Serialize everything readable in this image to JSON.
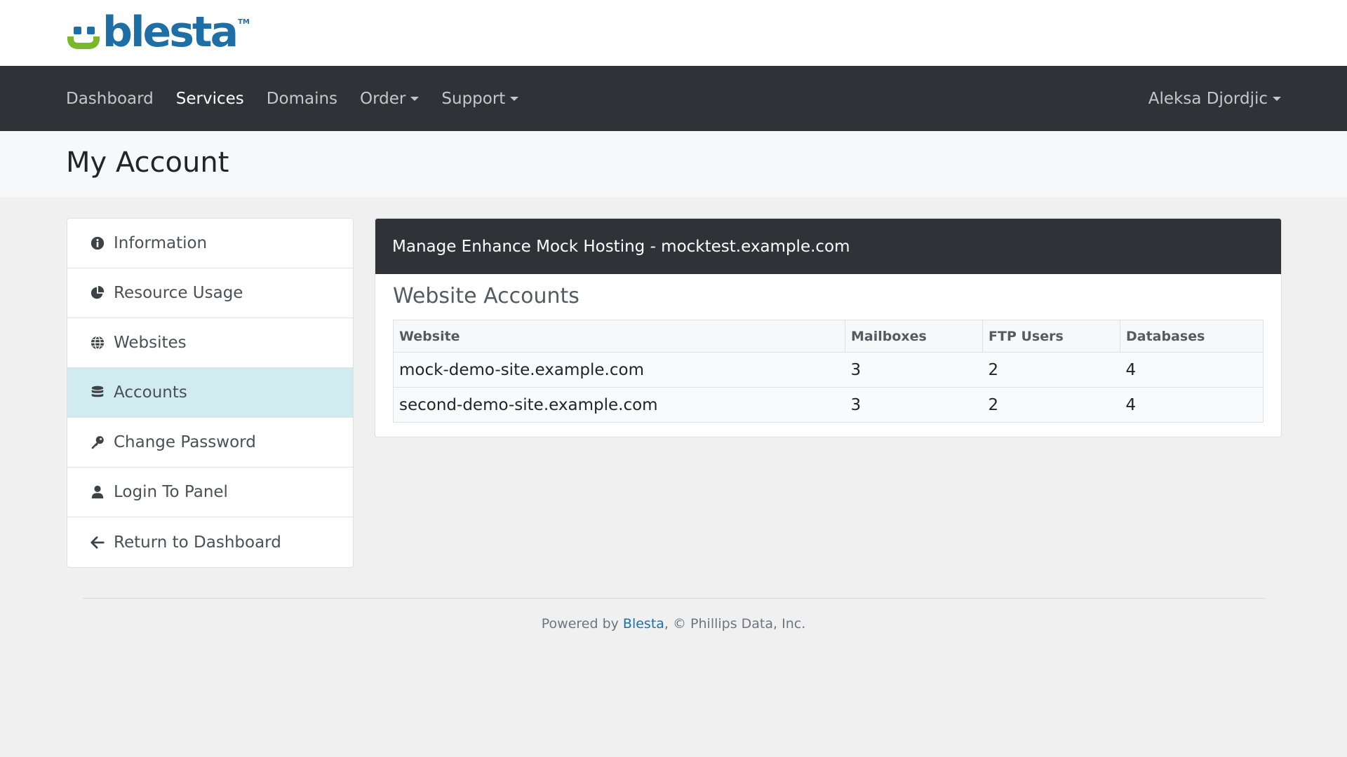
{
  "brand": {
    "logo_text": "blesta",
    "logo_tm": "TM",
    "colors": {
      "primary": "#1d6fa5",
      "green": "#78b82a"
    }
  },
  "navbar": {
    "items": [
      {
        "label": "Dashboard",
        "active": false,
        "dropdown": false
      },
      {
        "label": "Services",
        "active": true,
        "dropdown": false
      },
      {
        "label": "Domains",
        "active": false,
        "dropdown": false
      },
      {
        "label": "Order",
        "active": false,
        "dropdown": true
      },
      {
        "label": "Support",
        "active": false,
        "dropdown": true
      }
    ],
    "user": "Aleksa Djordjic"
  },
  "page": {
    "title": "My Account"
  },
  "sidebar": {
    "items": [
      {
        "label": "Information",
        "icon": "info-circle-icon",
        "active": false
      },
      {
        "label": "Resource Usage",
        "icon": "pie-chart-icon",
        "active": false
      },
      {
        "label": "Websites",
        "icon": "globe-icon",
        "active": false
      },
      {
        "label": "Accounts",
        "icon": "database-icon",
        "active": true
      },
      {
        "label": "Change Password",
        "icon": "key-icon",
        "active": false
      },
      {
        "label": "Login To Panel",
        "icon": "user-icon",
        "active": false
      },
      {
        "label": "Return to Dashboard",
        "icon": "arrow-left-icon",
        "active": false
      }
    ]
  },
  "main": {
    "header": "Manage Enhance Mock Hosting - mocktest.example.com",
    "section_title": "Website Accounts",
    "table": {
      "columns": [
        "Website",
        "Mailboxes",
        "FTP Users",
        "Databases"
      ],
      "rows": [
        [
          "mock-demo-site.example.com",
          "3",
          "2",
          "4"
        ],
        [
          "second-demo-site.example.com",
          "3",
          "2",
          "4"
        ]
      ]
    }
  },
  "footer": {
    "prefix": "Powered by ",
    "link": "Blesta",
    "suffix": ", © Phillips Data, Inc."
  }
}
